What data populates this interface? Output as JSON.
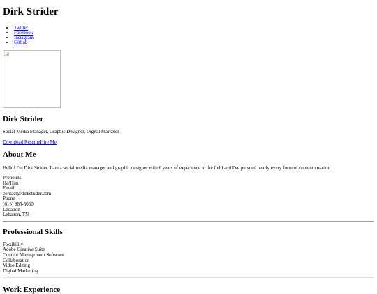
{
  "header": {
    "title": "Dirk Strider"
  },
  "social": {
    "items": [
      {
        "label": "Twitter"
      },
      {
        "label": "Facebook"
      },
      {
        "label": "Instagram"
      },
      {
        "label": "Github"
      }
    ]
  },
  "profile": {
    "photo_icon": "broken-image-icon",
    "name": "Dirk Strider",
    "tagline": "Social Media Manager, Graphic Designer, Digital Marketer",
    "download_resume": "Download Resume",
    "hire_me": "Hire Me"
  },
  "about": {
    "heading": "About Me",
    "text": "Hello! I'm Dirk Strider. I am a social media manager and graphic designer with 6 years of experience in the field and I've pursued nearly every form of content creation.",
    "contact": [
      {
        "label": "Pronouns",
        "value": "He/Him"
      },
      {
        "label": "Email",
        "value": "contact@dirkstrider.com"
      },
      {
        "label": "Phone",
        "value": "(615) 965-5050"
      },
      {
        "label": "Location",
        "value": "Lebanon, TN"
      }
    ]
  },
  "skills": {
    "heading": "Professional Skills",
    "items": [
      "Flexibility",
      "Adobe Creative Suite",
      "Content Management Software",
      "Collaboration",
      "Video Editing",
      "Digital Marketing"
    ]
  },
  "work": {
    "heading": "Work Experience"
  }
}
